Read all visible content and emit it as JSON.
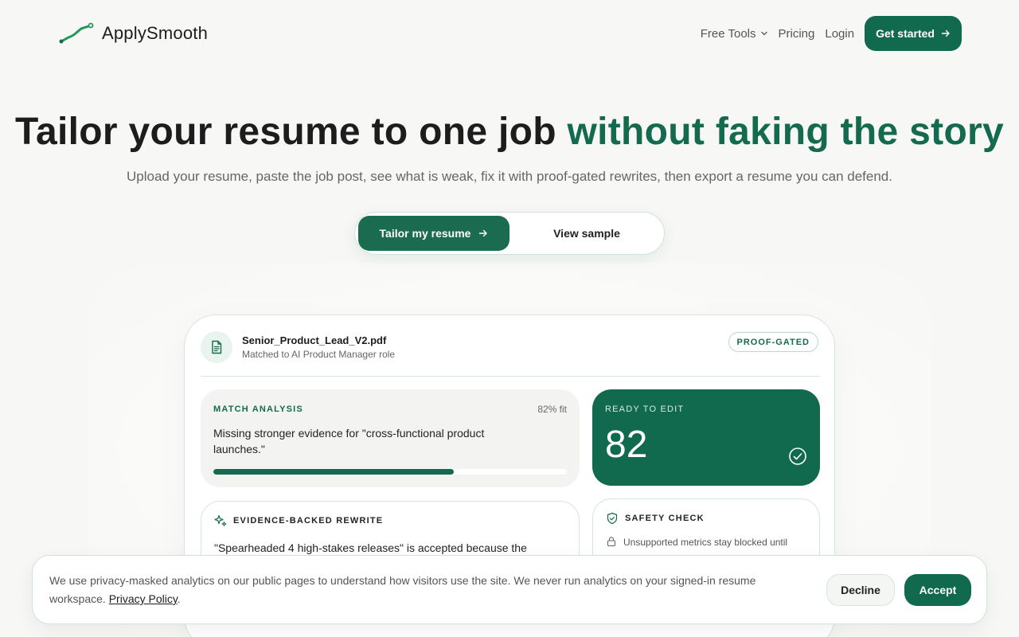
{
  "brand": {
    "name": "ApplySmooth",
    "logo_icon": "trend-line-icon",
    "accent": "#116a4d"
  },
  "nav": {
    "items": [
      {
        "label": "Free Tools",
        "has_dropdown": true
      },
      {
        "label": "Pricing"
      },
      {
        "label": "Login"
      }
    ],
    "cta_label": "Get started"
  },
  "hero": {
    "title_main": "Tailor your resume to one job ",
    "title_accent": "without faking the story",
    "subtitle": "Upload your resume, paste the job post, see what is weak, fix it with proof-gated rewrites, then export a resume you can defend.",
    "primary_cta": "Tailor my resume",
    "secondary_cta": "View sample"
  },
  "preview": {
    "file_name": "Senior_Product_Lead_V2.pdf",
    "file_subtitle": "Matched to AI Product Manager role",
    "badge": "PROOF-GATED",
    "match": {
      "label": "MATCH ANALYSIS",
      "fit": "82% fit",
      "text": "Missing stronger evidence for \"cross-functional product launches.\"",
      "progress": 0.68
    },
    "ready": {
      "label": "READY TO EDIT",
      "score": "82"
    },
    "rewrite": {
      "label": "EVIDENCE-BACKED REWRITE",
      "text": "\"Spearheaded 4 high-stakes releases\" is accepted because the"
    },
    "safety": {
      "label": "SAFETY CHECK",
      "text": "Unsupported metrics stay blocked until"
    }
  },
  "cookie": {
    "text": "We use privacy-masked analytics on our public pages to understand how visitors use the site. We never run analytics on your signed-in resume workspace. ",
    "link": "Privacy Policy",
    "link_suffix": ".",
    "decline": "Decline",
    "accept": "Accept"
  }
}
